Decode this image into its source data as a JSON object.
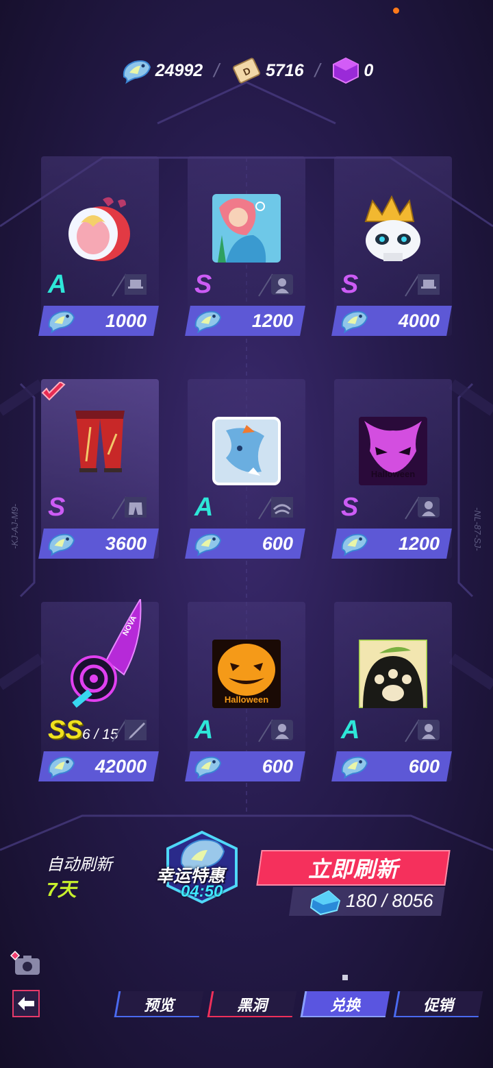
{
  "currency": [
    {
      "icon": "fish-icon",
      "value": "24992"
    },
    {
      "icon": "coin-d-icon",
      "value": "5716"
    },
    {
      "icon": "cube-icon",
      "value": "0"
    }
  ],
  "side_left": "-KJ-AJ-M9-",
  "side_right": "-NL-87-SJ-",
  "items": [
    {
      "name": "hood hat",
      "rank": "A",
      "type_icon": "hat-icon",
      "price": "1000"
    },
    {
      "name": "mermaid avatar",
      "rank": "S",
      "type_icon": "avatar-icon",
      "price": "1200"
    },
    {
      "name": "crowned skull",
      "rank": "S",
      "type_icon": "hat-icon",
      "price": "4000"
    },
    {
      "name": "red pants",
      "rank": "S",
      "type_icon": "pants-icon",
      "price": "3600",
      "owned": true
    },
    {
      "name": "shark fin emote",
      "rank": "A",
      "type_icon": "eyes-icon",
      "price": "600"
    },
    {
      "name": "halloween demon avatar",
      "rank": "S",
      "type_icon": "avatar-icon",
      "price": "1200",
      "img_text": "Halloween"
    },
    {
      "name": "nova blade",
      "rank": "SS",
      "fragments": "6 / 15",
      "type_icon": "sword-icon",
      "price": "42000"
    },
    {
      "name": "halloween pumpkin avatar",
      "rank": "A",
      "type_icon": "avatar-icon",
      "price": "600",
      "img_text": "Halloween"
    },
    {
      "name": "paw avatar",
      "rank": "A",
      "type_icon": "avatar-icon",
      "price": "600"
    }
  ],
  "nova_text": "NOVA",
  "auto_refresh": {
    "label": "自动刷新",
    "days": "7天"
  },
  "lucky": {
    "title": "幸运特惠",
    "timer": "04:50"
  },
  "refresh": {
    "label": "立即刷新",
    "cost": "180 / 8056"
  },
  "tabs": [
    {
      "label": "预览",
      "active": false
    },
    {
      "label": "黑洞",
      "active": false
    },
    {
      "label": "兑换",
      "active": true
    },
    {
      "label": "促销",
      "active": false
    }
  ],
  "colors": {
    "price_bar": "#5d58d6",
    "refresh": "#f5305c",
    "rank_A": "#2ee6d8",
    "rank_S": "#cc5cf5",
    "rank_SS": "#f0e21e"
  }
}
